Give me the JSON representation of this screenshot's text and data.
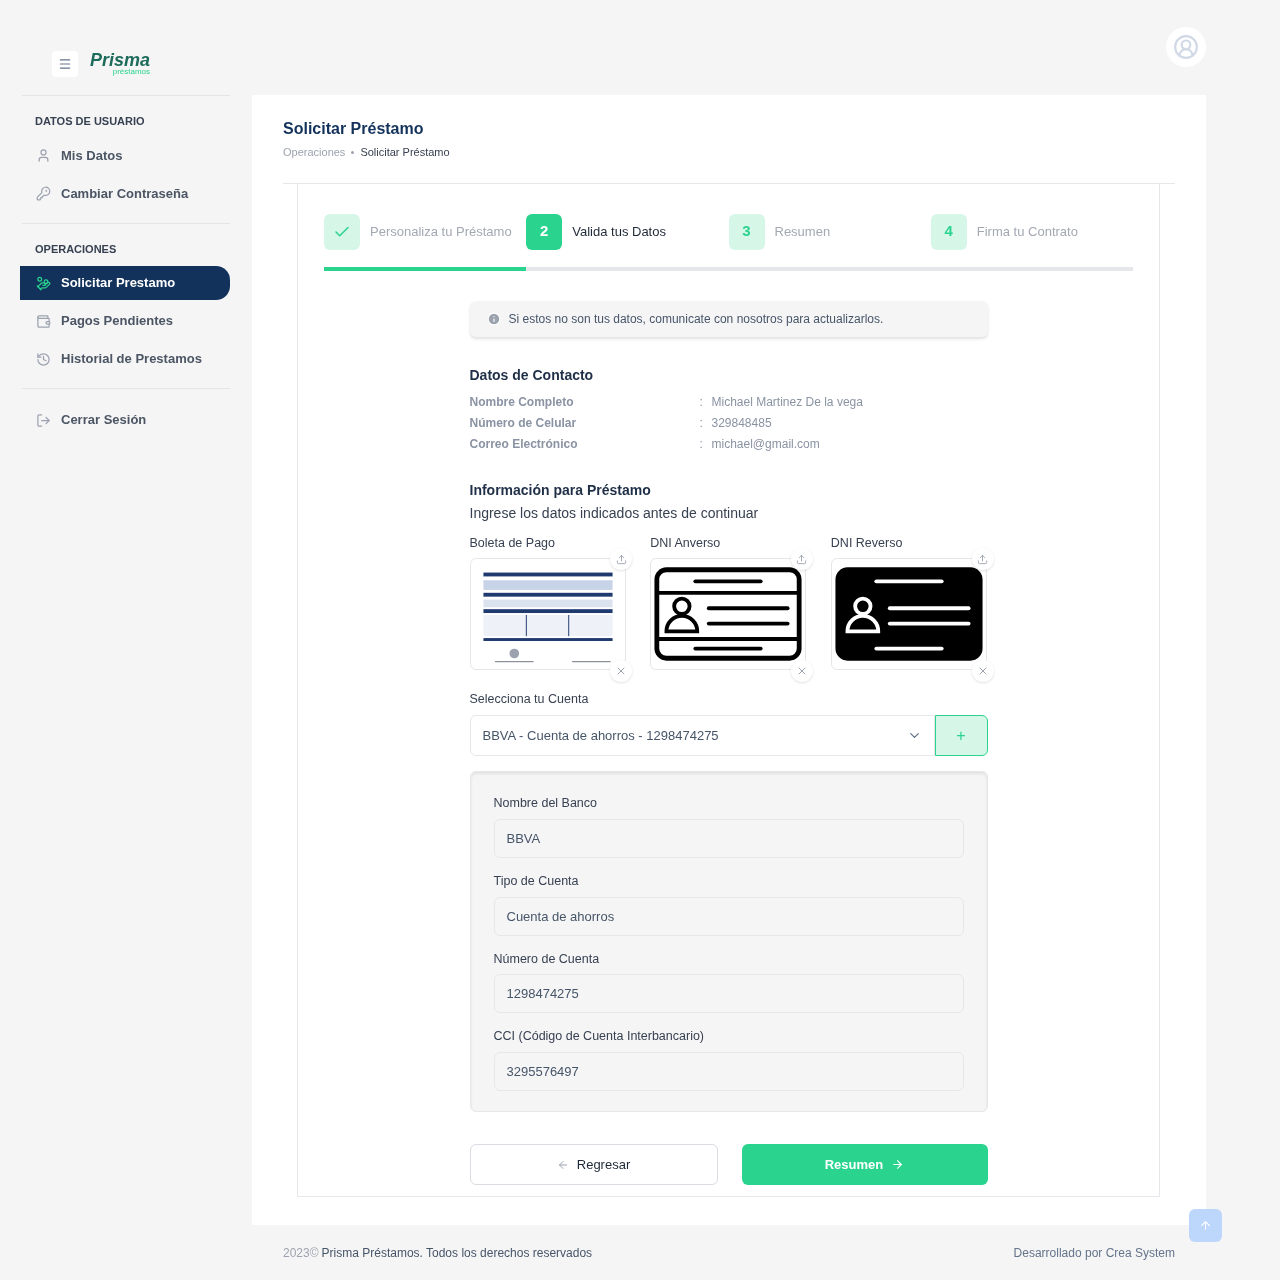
{
  "logo": {
    "name": "Prisma",
    "tagline": "préstamos"
  },
  "sidebar": {
    "sections": [
      {
        "title": "DATOS DE USUARIO",
        "items": [
          {
            "label": "Mis Datos",
            "selected": false
          },
          {
            "label": "Cambiar Contraseña",
            "selected": false
          }
        ]
      },
      {
        "title": "OPERACIONES",
        "items": [
          {
            "label": "Solicitar Prestamo",
            "selected": true
          },
          {
            "label": "Pagos Pendientes",
            "selected": false
          },
          {
            "label": "Historial de Prestamos",
            "selected": false
          }
        ]
      },
      {
        "items": [
          {
            "label": "Cerrar Sesión",
            "selected": false
          }
        ]
      }
    ]
  },
  "page": {
    "title": "Solicitar Préstamo",
    "breadcrumb": [
      "Operaciones",
      "Solicitar Préstamo"
    ]
  },
  "stepper": {
    "level": 0.25,
    "steps": [
      {
        "label": "Personaliza tu Préstamo",
        "completed": true,
        "selected": false
      },
      {
        "number": "2",
        "label": "Valida tus Datos",
        "completed": false,
        "selected": true
      },
      {
        "number": "3",
        "label": "Resumen",
        "completed": false,
        "selected": false
      },
      {
        "number": "4",
        "label": "Firma tu Contrato",
        "completed": false,
        "selected": false
      }
    ]
  },
  "notice": "Si estos no son tus datos, comunicate con nosotros para actualizarlos.",
  "contact": {
    "title": "Datos de Contacto",
    "rows": [
      {
        "label": "Nombre Completo",
        "separator": ":",
        "value": "Michael Martinez De la vega"
      },
      {
        "label": "Número de Celular",
        "separator": ":",
        "value": "329848485"
      },
      {
        "label": "Correo Electrónico",
        "separator": ":",
        "value": "michael@gmail.com"
      }
    ]
  },
  "loan_info": {
    "title": "Información para Préstamo",
    "subtitle": "Ingrese los datos indicados antes de continuar",
    "uploads": [
      {
        "label": "Boleta de Pago",
        "kind": "document"
      },
      {
        "label": "DNI Anverso",
        "kind": "id_front"
      },
      {
        "label": "DNI Reverso",
        "kind": "id_back"
      }
    ],
    "account_label": "Selecciona tu Cuenta",
    "account_value": "BBVA - Cuenta de ahorros - 1298474275",
    "add_button": "+",
    "fields": [
      {
        "label": "Nombre del Banco",
        "value": "BBVA"
      },
      {
        "label": "Tipo de Cuenta",
        "value": "Cuenta de ahorros"
      },
      {
        "label": "Número de Cuenta",
        "value": "1298474275"
      },
      {
        "label": "CCI (Código de Cuenta Interbancario)",
        "value": "3295576497"
      }
    ]
  },
  "buttons": {
    "back": "Regresar",
    "next": "Resumen"
  },
  "footer": {
    "year": "2023©",
    "copyright": "Prisma Préstamos. Todos los derechos reservados",
    "credit": "Desarrollado por Crea System"
  }
}
